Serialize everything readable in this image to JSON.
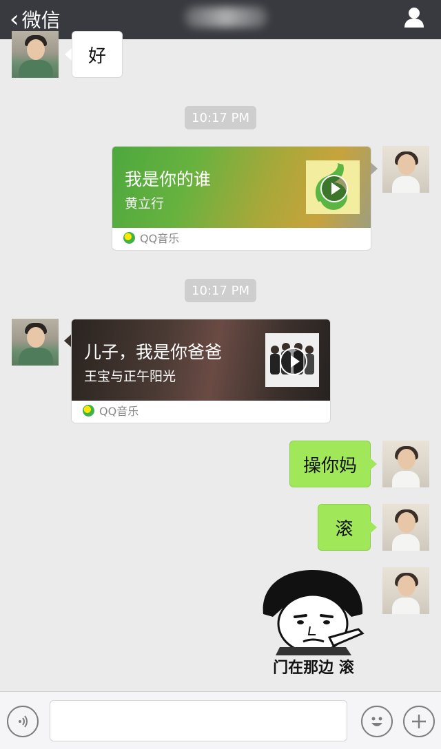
{
  "nav": {
    "back_label": "微信"
  },
  "messages": {
    "m1_text": "好",
    "ts1": "10:17 PM",
    "music1": {
      "title": "我是你的谁",
      "artist": "黄立行",
      "source": "QQ音乐"
    },
    "ts2": "10:17 PM",
    "music2": {
      "title": "儿子，我是你爸爸",
      "artist": "王宝与正午阳光",
      "source": "QQ音乐"
    },
    "m_out1": "操你妈",
    "m_out2": "滚",
    "meme_caption": "门在那边 滚"
  },
  "colors": {
    "nav_bg": "#393a3f",
    "chat_bg": "#ebebeb",
    "outgoing_bubble": "#a0e75a",
    "incoming_bubble": "#ffffff",
    "timestamp_bg": "#cecece"
  },
  "icons": {
    "back": "chevron-left-icon",
    "profile": "user-icon",
    "voice": "voice-icon",
    "emoji": "emoji-icon",
    "more": "plus-icon"
  }
}
